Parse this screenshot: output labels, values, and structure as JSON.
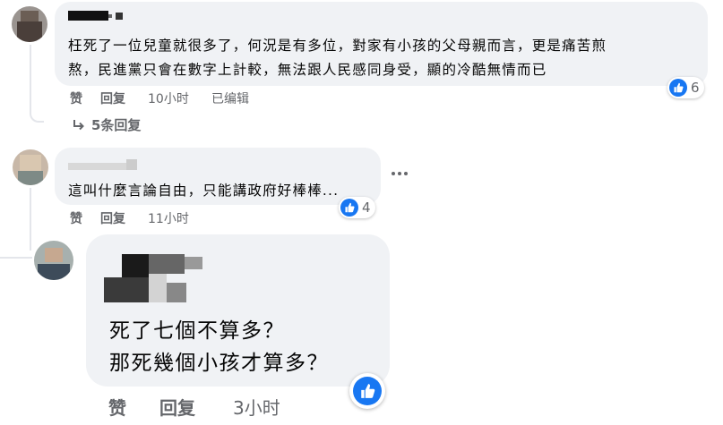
{
  "comments": [
    {
      "text_line1": "枉死了一位兒童就很多了，何況是有多位，對家有小孩的父母親而言，更是痛苦煎",
      "text_line2": "熬，民進黨只會在數字上計較，無法跟人民感同身受，顯的冷酷無情而已",
      "like_label": "赞",
      "reply_label": "回复",
      "time": "10小时",
      "edited": "已编辑",
      "reaction_count": "6",
      "replies_link": "5条回复"
    },
    {
      "text": "這叫什麼言論自由，只能講政府好棒棒...",
      "like_label": "赞",
      "reply_label": "回复",
      "time": "11小时",
      "reaction_count": "4",
      "more_icon": "more-horizontal-icon"
    },
    {
      "text_line1": "死了七個不算多？",
      "text_line2": "那死幾個小孩才算多？",
      "like_label": "赞",
      "reply_label": "回复",
      "time": "3小时"
    }
  ],
  "colors": {
    "bubble": "#f0f2f5",
    "meta": "#65676b",
    "like_blue": "#1877f2"
  }
}
